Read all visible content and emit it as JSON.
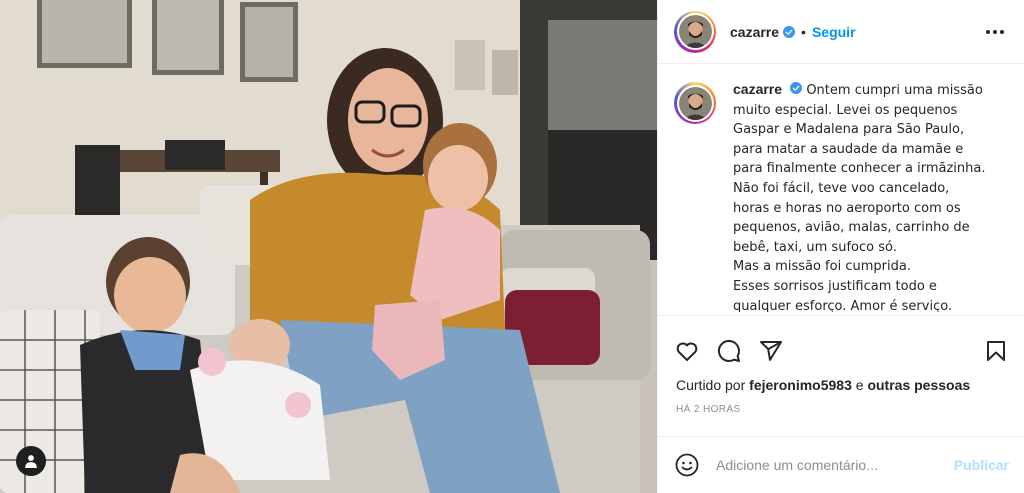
{
  "post": {
    "username": "cazarre",
    "separator": "•",
    "follow_label": "Seguir",
    "caption_lines": [
      "Ontem cumpri uma missão",
      "muito especial. Levei os pequenos",
      "Gaspar e Madalena para São Paulo,",
      "para matar a saudade da mamãe e",
      "para finalmente conhecer a irmãzinha.",
      "Não foi fácil, teve voo cancelado,",
      "horas e horas no aeroporto com os",
      "pequenos, avião, malas, carrinho de",
      "bebê, taxi, um sufoco só.",
      "Mas a missão foi cumprida.",
      "Esses sorrisos justificam todo e",
      "qualquer esforço. Amor é serviço."
    ]
  },
  "likes": {
    "prefix": "Curtido por",
    "user": "fejeronimo5983",
    "middle": "e",
    "others": "outras pessoas"
  },
  "timestamp": "HÁ 2 HORAS",
  "comment": {
    "placeholder": "Adicione um comentário...",
    "publish_label": "Publicar"
  },
  "icons": {
    "verified": "verified-badge-icon",
    "more": "more-options-icon",
    "like": "heart-icon",
    "comment": "comment-icon",
    "share": "paper-plane-icon",
    "save": "bookmark-icon",
    "emoji": "smiley-icon",
    "tags": "user-tag-icon"
  },
  "colors": {
    "accent": "#0095f6",
    "publish_disabled": "#b2dffc",
    "verified": "#3897f0",
    "muted": "#8e8e8e"
  }
}
